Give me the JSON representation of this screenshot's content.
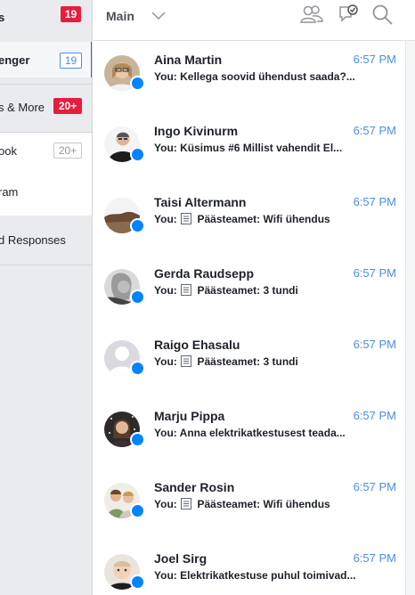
{
  "sidebar": {
    "items": [
      {
        "label": "s",
        "badge": "19"
      },
      {
        "label": "enger",
        "badge": "19"
      },
      {
        "label": "s & More",
        "badge": "20+"
      },
      {
        "label": "ook",
        "badge": "20+"
      },
      {
        "label": "ram"
      },
      {
        "label": "d Responses"
      }
    ]
  },
  "header": {
    "title": "Main",
    "icons": [
      "people-icon",
      "chat-check-icon",
      "search-icon"
    ]
  },
  "conversations": [
    {
      "name": "Aina Martin",
      "time": "6:57 PM",
      "snippet": "You: Kellega soovid ühendust saada?...",
      "has_doc": false
    },
    {
      "name": "Ingo Kivinurm",
      "time": "6:57 PM",
      "snippet": "You: Küsimus #6 Millist vahendit El...",
      "has_doc": false
    },
    {
      "name": "Taisi Altermann",
      "time": "6:57 PM",
      "snippet_prefix": "You:",
      "snippet": "Päästeamet: Wifi ühendus",
      "has_doc": true
    },
    {
      "name": "Gerda Raudsepp",
      "time": "6:57 PM",
      "snippet_prefix": "You:",
      "snippet": "Päästeamet: 3 tundi",
      "has_doc": true
    },
    {
      "name": "Raigo Ehasalu",
      "time": "6:57 PM",
      "snippet_prefix": "You:",
      "snippet": "Päästeamet: 3 tundi",
      "has_doc": true
    },
    {
      "name": "Marju Pippa",
      "time": "6:57 PM",
      "snippet": "You: Anna elektrikatkestusest teada...",
      "has_doc": false
    },
    {
      "name": "Sander Rosin",
      "time": "6:57 PM",
      "snippet_prefix": "You:",
      "snippet": "Päästeamet: Wifi ühendus",
      "has_doc": true
    },
    {
      "name": "Joel Sirg",
      "time": "6:57 PM",
      "snippet": "You: Elektrikatkestuse puhul toimivad...",
      "has_doc": false
    }
  ],
  "colors": {
    "accent": "#4a90e2",
    "badge_red": "#e41e3f",
    "messenger": "#0084ff"
  }
}
